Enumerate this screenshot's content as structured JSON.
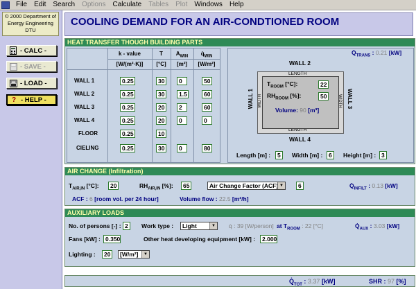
{
  "menubar": {
    "items": [
      "File",
      "Edit",
      "Search",
      "Options",
      "Calculate",
      "Tables",
      "Plot",
      "Windows",
      "Help"
    ],
    "disabled": [
      "Options",
      "Tables",
      "Plot"
    ]
  },
  "logo": {
    "line1": "© 2000 Department of",
    "line2": "Energy Engineering",
    "line3": "DTU"
  },
  "sidebar": {
    "calc": "- CALC -",
    "save": "- SAVE -",
    "load": "- LOAD -",
    "help": "- HELP -"
  },
  "title": "COOLING DEMAND FOR AN AIR-CONDTIONED ROOM",
  "heat": {
    "header": "HEAT TRANSFER THOUGH BUILDING PARTS",
    "col_k": "k - value",
    "col_k_unit": "[W/(m²·K)]",
    "col_t": "T",
    "col_t_unit": "[°C]",
    "col_a": "A",
    "col_a_sub": "WIN",
    "col_a_unit": "[m²]",
    "col_q": "q̇",
    "col_q_sub": "WIN",
    "col_q_unit": "[W/m²]",
    "rows": [
      {
        "name": "WALL 1",
        "k": "0.25",
        "t": "30",
        "a": "0",
        "q": "50"
      },
      {
        "name": "WALL 2",
        "k": "0.25",
        "t": "30",
        "a": "1.5",
        "q": "60"
      },
      {
        "name": "WALL 3",
        "k": "0.25",
        "t": "20",
        "a": "2",
        "q": "60"
      },
      {
        "name": "WALL 4",
        "k": "0.25",
        "t": "20",
        "a": "0",
        "q": "0"
      },
      {
        "name": "FLOOR",
        "k": "0.25",
        "t": "10",
        "a": "",
        "q": ""
      },
      {
        "name": "CIELING",
        "k": "0.25",
        "t": "30",
        "a": "0",
        "q": "80"
      }
    ],
    "qtrans_label": "Q̇",
    "qtrans_sub": "TRANS",
    "qtrans_value": "0.21",
    "qtrans_unit": "[kW]"
  },
  "room": {
    "wall1": "WALL 1",
    "wall2": "WALL 2",
    "wall3": "WALL 3",
    "wall4": "WALL 4",
    "length": "LENGTH",
    "width": "WIDTH",
    "troom_label": "T",
    "troom_sub": "ROOM",
    "troom_unit": "[°C]:",
    "troom_value": "22",
    "rh_label": "RH",
    "rh_sub": "ROOM",
    "rh_unit": "[%]:",
    "rh_value": "50",
    "volume_label": "Volume:",
    "volume_value": "90",
    "volume_unit": "[m³]",
    "length_label": "Length [m] :",
    "length_value": "5",
    "width_label": "Width [m] :",
    "width_value": "6",
    "height_label": "Height [m] :",
    "height_value": "3"
  },
  "air": {
    "header": "AIR CHANGE (Infiltration)",
    "tair_label": "T",
    "tair_sub": "AIR,IN",
    "tair_unit": "[°C]:",
    "tair_value": "20",
    "rhair_label": "RH",
    "rhair_sub": "AIR,IN",
    "rhair_unit": "[%]:",
    "rhair_value": "65",
    "acf_select": "Air Change Factor (ACF)",
    "acf_value": "6",
    "qinfilt_label": "Q̇",
    "qinfilt_sub": "INFILT",
    "qinfilt_value": "0.13",
    "qinfilt_unit": "[kW]",
    "acf_label": "ACF :",
    "acf_num": "6",
    "acf_desc": "[room vol. per 24 hour]",
    "flow_label": "Volume flow :",
    "flow_value": "22.5",
    "flow_unit": "[m³/h]"
  },
  "aux": {
    "header": "AUXILIARY LOADS",
    "persons_label": "No. of persons [-] :",
    "persons_value": "2",
    "worktype_label": "Work type :",
    "worktype_value": "Light",
    "qdot_label": "q̇ :",
    "qdot_value": "39",
    "qdot_unit": "[W/person]",
    "at_label": "at T",
    "at_sub": "ROOM",
    "at_value": ": 22 [°C]",
    "qaux_label": "Q̇",
    "qaux_sub": "AUX",
    "qaux_value": "3.03",
    "qaux_unit": "[kW]",
    "fans_label": "Fans [kW] :",
    "fans_value": "0.350",
    "other_label": "Other heat developing equipment [kW] :",
    "other_value": "2.000",
    "lighting_label": "Lighting :",
    "lighting_value": "20",
    "lighting_unit": "[W/m²]"
  },
  "footer": {
    "qtot_label": "Q̇",
    "qtot_sub": "TOT",
    "qtot_value": "3.37",
    "qtot_unit": "[kW]",
    "shr_label": "SHR :",
    "shr_value": "97",
    "shr_unit": "[%]"
  },
  "icons": {
    "calc": "calculator-icon",
    "save": "floppy-icon",
    "load": "folder-icon",
    "help": "question-icon"
  }
}
